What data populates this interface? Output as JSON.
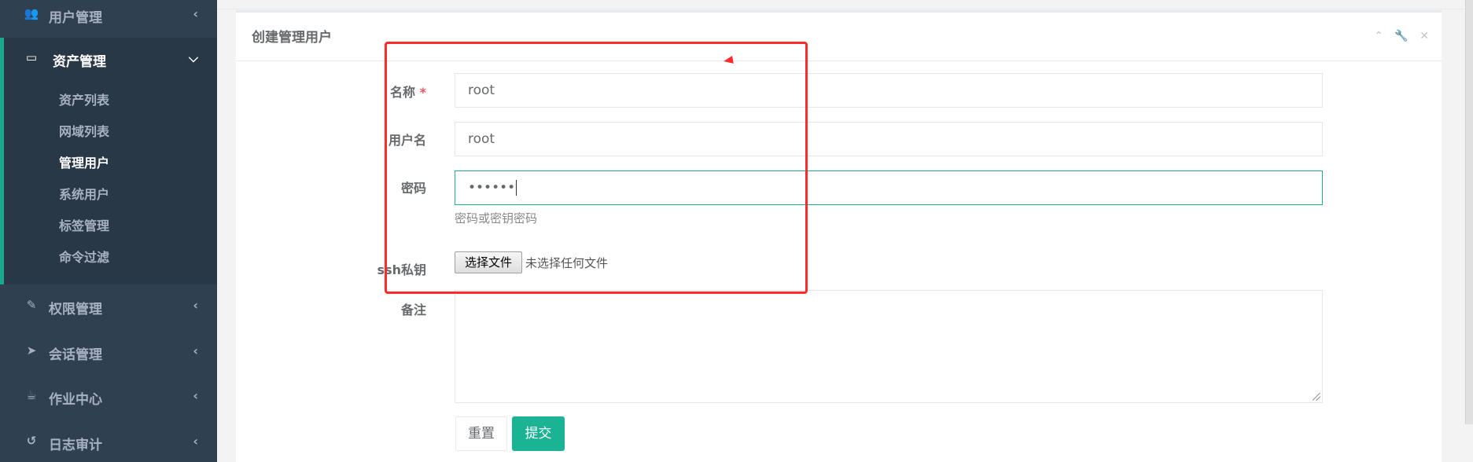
{
  "sidebar": {
    "items": [
      {
        "label": "用户管理",
        "icon": "users-icon"
      },
      {
        "label": "资产管理",
        "icon": "hdd-icon",
        "expanded": true
      },
      {
        "label": "权限管理",
        "icon": "edit-icon"
      },
      {
        "label": "会话管理",
        "icon": "rocket-icon"
      },
      {
        "label": "作业中心",
        "icon": "coffee-icon"
      },
      {
        "label": "日志审计",
        "icon": "history-icon"
      }
    ],
    "subitems": [
      "资产列表",
      "网域列表",
      "管理用户",
      "系统用户",
      "标签管理",
      "命令过滤"
    ],
    "current_subitem": "管理用户"
  },
  "panel": {
    "title": "创建管理用户"
  },
  "form": {
    "name_label": "名称",
    "required_mark": "*",
    "name_value": "root",
    "username_label": "用户名",
    "username_value": "root",
    "password_label": "密码",
    "password_value": "••••••",
    "password_help": "密码或密钥密码",
    "sshkey_label": "ssh私钥",
    "file_button": "选择文件",
    "file_status": "未选择任何文件",
    "comment_label": "备注",
    "reset_button": "重置",
    "submit_button": "提交"
  },
  "colors": {
    "sidebar_bg": "#2f4050",
    "accent": "#1ab394",
    "annotation": "#ff2a2a"
  }
}
